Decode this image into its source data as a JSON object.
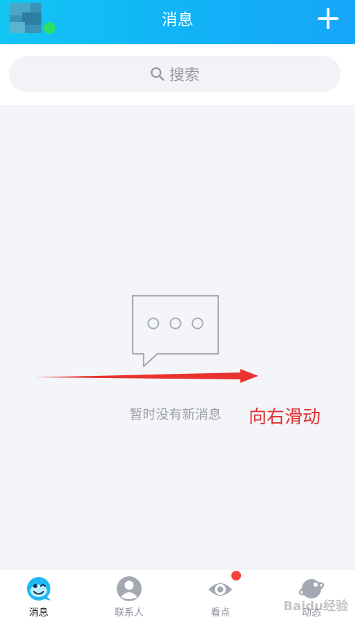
{
  "header": {
    "title": "消息"
  },
  "search": {
    "placeholder": "搜索"
  },
  "empty_state": {
    "message": "暂时没有新消息"
  },
  "annotation": {
    "text": "向右滑动",
    "color": "#e03333"
  },
  "tabs": [
    {
      "label": "消息",
      "icon": "chat-bubble-face-icon",
      "active": true
    },
    {
      "label": "联系人",
      "icon": "contact-person-icon",
      "active": false
    },
    {
      "label": "看点",
      "icon": "eye-icon",
      "active": false
    },
    {
      "label": "动态",
      "icon": "planet-icon",
      "active": false
    }
  ],
  "colors": {
    "header": "#12b3f7",
    "online": "#2ee063",
    "badge": "#f4433a"
  },
  "watermark": {
    "text": "Baidu经验"
  }
}
